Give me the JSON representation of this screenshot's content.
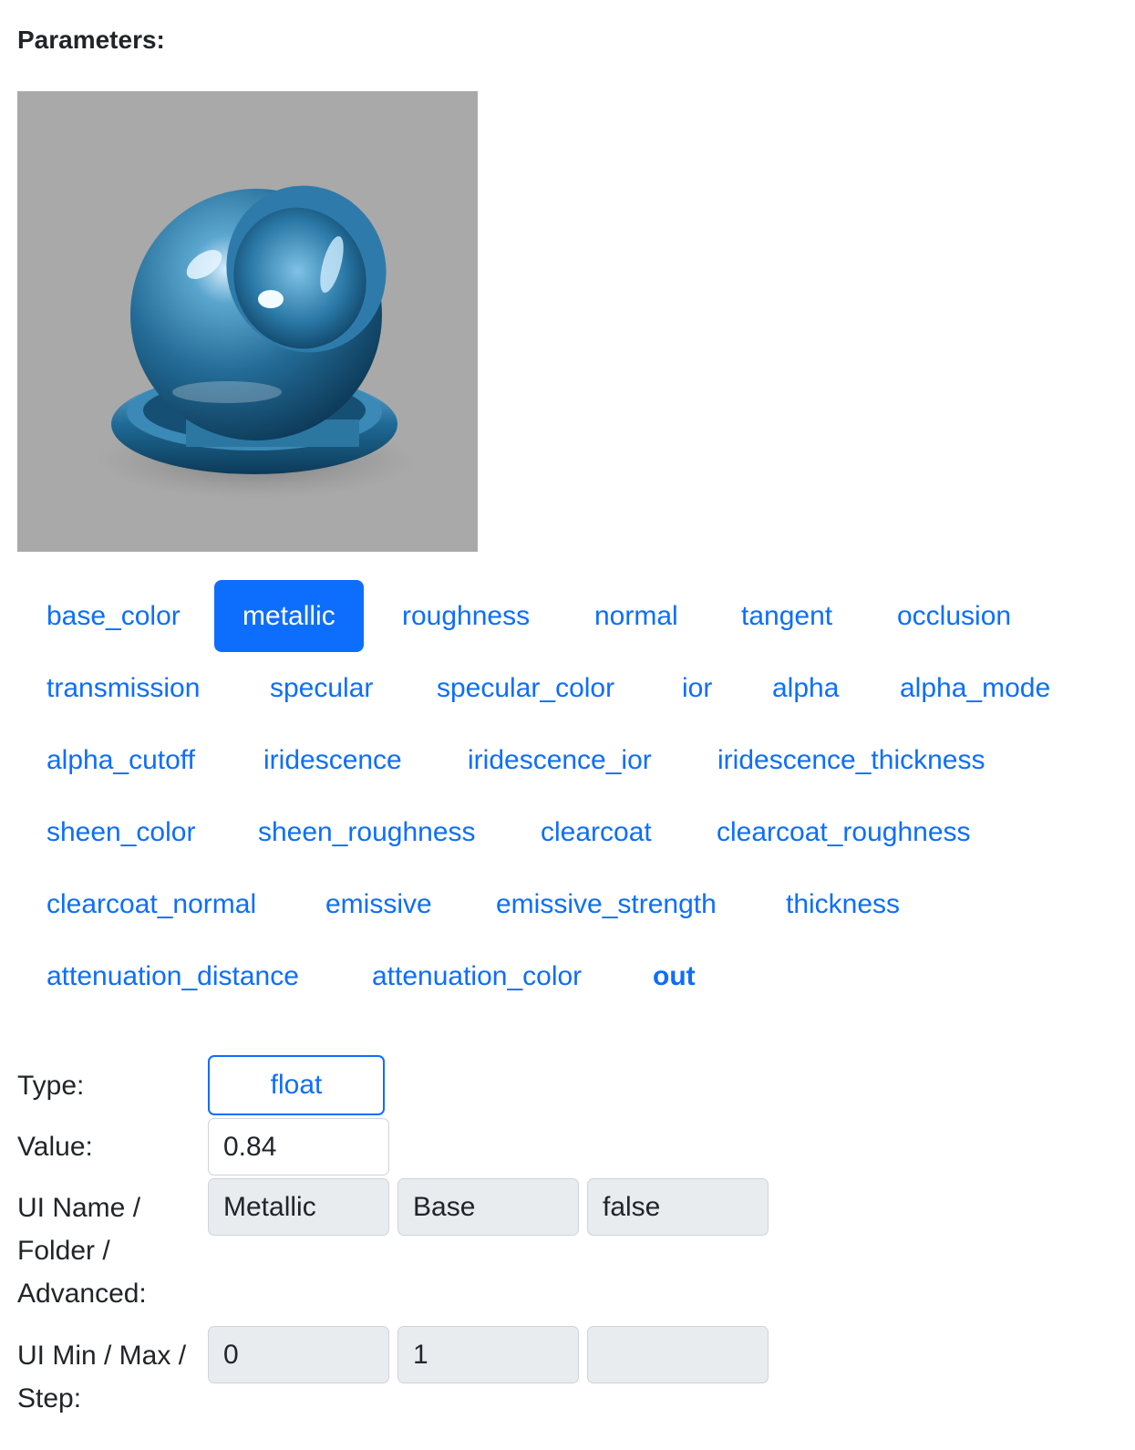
{
  "heading": "Parameters:",
  "tabs": {
    "row1": [
      "base_color",
      "metallic",
      "roughness",
      "normal",
      "tangent",
      "occlusion"
    ],
    "row2": [
      "transmission",
      "specular",
      "specular_color",
      "ior",
      "alpha",
      "alpha_mode"
    ],
    "row3": [
      "alpha_cutoff",
      "iridescence",
      "iridescence_ior",
      "iridescence_thickness"
    ],
    "row4": [
      "sheen_color",
      "sheen_roughness",
      "clearcoat",
      "clearcoat_roughness"
    ],
    "row5": [
      "clearcoat_normal",
      "emissive",
      "emissive_strength",
      "thickness"
    ],
    "row6": [
      "attenuation_distance",
      "attenuation_color",
      "out"
    ],
    "active": "metallic"
  },
  "form": {
    "type_label": "Type:",
    "type_value": "float",
    "value_label": "Value:",
    "value": "0.84",
    "ui_label_1": "UI Name /",
    "ui_label_2": "Folder /",
    "ui_label_3": "Advanced:",
    "ui_name": "Metallic",
    "folder": "Base",
    "advanced": "false",
    "range_label_1": "UI Min / Max /",
    "range_label_2": "Step:",
    "ui_min": "0",
    "ui_max": "1",
    "ui_step": ""
  },
  "colors": {
    "accent": "#0d6efd",
    "preview_bg": "#a9a9a9",
    "sphere": "#2f7aa6"
  }
}
